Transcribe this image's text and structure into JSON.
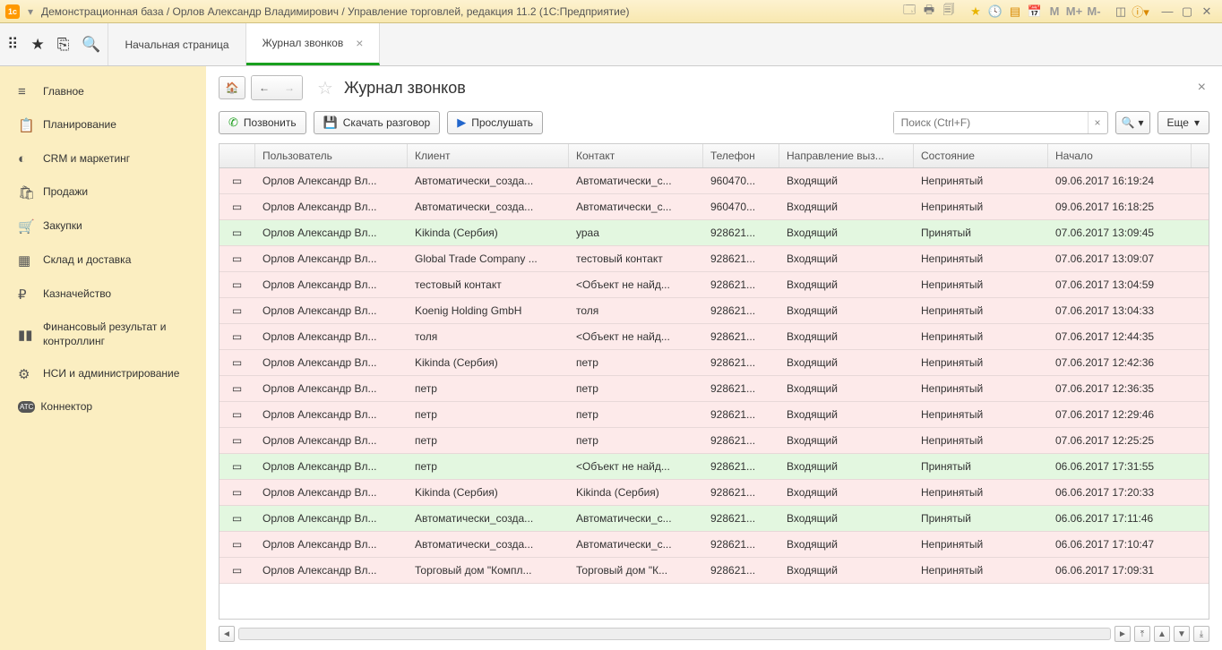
{
  "titlebar": {
    "title": "Демонстрационная база / Орлов Александр Владимирович / Управление торговлей, редакция 11.2  (1С:Предприятие)"
  },
  "tabs": {
    "home": "Начальная страница",
    "active": "Журнал звонков"
  },
  "sidebar": [
    {
      "icon": "≡",
      "label": "Главное"
    },
    {
      "icon": "📋",
      "label": "Планирование"
    },
    {
      "icon": "◐",
      "label": "CRM и маркетинг"
    },
    {
      "icon": "🛍",
      "label": "Продажи"
    },
    {
      "icon": "🛒",
      "label": "Закупки"
    },
    {
      "icon": "▦",
      "label": "Склад и доставка"
    },
    {
      "icon": "₽",
      "label": "Казначейство"
    },
    {
      "icon": "▮▮",
      "label": "Финансовый результат и контроллинг"
    },
    {
      "icon": "⚙",
      "label": "НСИ и администрирование"
    },
    {
      "icon": "ATC",
      "label": "Коннектор"
    }
  ],
  "page": {
    "title": "Журнал звонков"
  },
  "toolbar": {
    "call": "Позвонить",
    "download": "Скачать разговор",
    "listen": "Прослушать",
    "search_placeholder": "Поиск (Ctrl+F)",
    "more": "Еще"
  },
  "columns": {
    "user": "Пользователь",
    "client": "Клиент",
    "contact": "Контакт",
    "phone": "Телефон",
    "dir": "Направление выз...",
    "state": "Состояние",
    "start": "Начало"
  },
  "rows": [
    {
      "s": "red",
      "user": "Орлов Александр Вл...",
      "client": "Автоматически_созда...",
      "contact": "Автоматически_с...",
      "phone": "960470...",
      "dir": "Входящий",
      "state": "Непринятый",
      "start": "09.06.2017 16:19:24"
    },
    {
      "s": "red",
      "user": "Орлов Александр Вл...",
      "client": "Автоматически_созда...",
      "contact": "Автоматически_с...",
      "phone": "960470...",
      "dir": "Входящий",
      "state": "Непринятый",
      "start": "09.06.2017 16:18:25"
    },
    {
      "s": "green",
      "user": "Орлов Александр Вл...",
      "client": "Kikinda (Сербия)",
      "contact": "ураа",
      "phone": "928621...",
      "dir": "Входящий",
      "state": "Принятый",
      "start": "07.06.2017 13:09:45"
    },
    {
      "s": "red",
      "user": "Орлов Александр Вл...",
      "client": "Global Trade Company ...",
      "contact": "тестовый контакт",
      "phone": "928621...",
      "dir": "Входящий",
      "state": "Непринятый",
      "start": "07.06.2017 13:09:07"
    },
    {
      "s": "red",
      "user": "Орлов Александр Вл...",
      "client": "тестовый контакт",
      "contact": "<Объект не найд...",
      "phone": "928621...",
      "dir": "Входящий",
      "state": "Непринятый",
      "start": "07.06.2017 13:04:59"
    },
    {
      "s": "red",
      "user": "Орлов Александр Вл...",
      "client": "Koenig Holding GmbH",
      "contact": "толя",
      "phone": "928621...",
      "dir": "Входящий",
      "state": "Непринятый",
      "start": "07.06.2017 13:04:33"
    },
    {
      "s": "red",
      "user": "Орлов Александр Вл...",
      "client": "толя",
      "contact": "<Объект не найд...",
      "phone": "928621...",
      "dir": "Входящий",
      "state": "Непринятый",
      "start": "07.06.2017 12:44:35"
    },
    {
      "s": "red",
      "user": "Орлов Александр Вл...",
      "client": "Kikinda (Сербия)",
      "contact": "петр",
      "phone": "928621...",
      "dir": "Входящий",
      "state": "Непринятый",
      "start": "07.06.2017 12:42:36"
    },
    {
      "s": "red",
      "user": "Орлов Александр Вл...",
      "client": "петр",
      "contact": "петр",
      "phone": "928621...",
      "dir": "Входящий",
      "state": "Непринятый",
      "start": "07.06.2017 12:36:35"
    },
    {
      "s": "red",
      "user": "Орлов Александр Вл...",
      "client": "петр",
      "contact": "петр",
      "phone": "928621...",
      "dir": "Входящий",
      "state": "Непринятый",
      "start": "07.06.2017 12:29:46"
    },
    {
      "s": "red",
      "user": "Орлов Александр Вл...",
      "client": "петр",
      "contact": "петр",
      "phone": "928621...",
      "dir": "Входящий",
      "state": "Непринятый",
      "start": "07.06.2017 12:25:25"
    },
    {
      "s": "green",
      "user": "Орлов Александр Вл...",
      "client": "петр",
      "contact": "<Объект не найд...",
      "phone": "928621...",
      "dir": "Входящий",
      "state": "Принятый",
      "start": "06.06.2017 17:31:55"
    },
    {
      "s": "red",
      "user": "Орлов Александр Вл...",
      "client": "Kikinda (Сербия)",
      "contact": "Kikinda (Сербия)",
      "phone": "928621...",
      "dir": "Входящий",
      "state": "Непринятый",
      "start": "06.06.2017 17:20:33"
    },
    {
      "s": "green",
      "user": "Орлов Александр Вл...",
      "client": "Автоматически_созда...",
      "contact": "Автоматически_с...",
      "phone": "928621...",
      "dir": "Входящий",
      "state": "Принятый",
      "start": "06.06.2017 17:11:46"
    },
    {
      "s": "red",
      "user": "Орлов Александр Вл...",
      "client": "Автоматически_созда...",
      "contact": "Автоматически_с...",
      "phone": "928621...",
      "dir": "Входящий",
      "state": "Непринятый",
      "start": "06.06.2017 17:10:47"
    },
    {
      "s": "red",
      "user": "Орлов Александр Вл...",
      "client": "Торговый дом \"Компл...",
      "contact": "Торговый дом \"К...",
      "phone": "928621...",
      "dir": "Входящий",
      "state": "Непринятый",
      "start": "06.06.2017 17:09:31"
    }
  ],
  "memory": {
    "m": "M",
    "mp": "M+",
    "mm": "M-"
  }
}
